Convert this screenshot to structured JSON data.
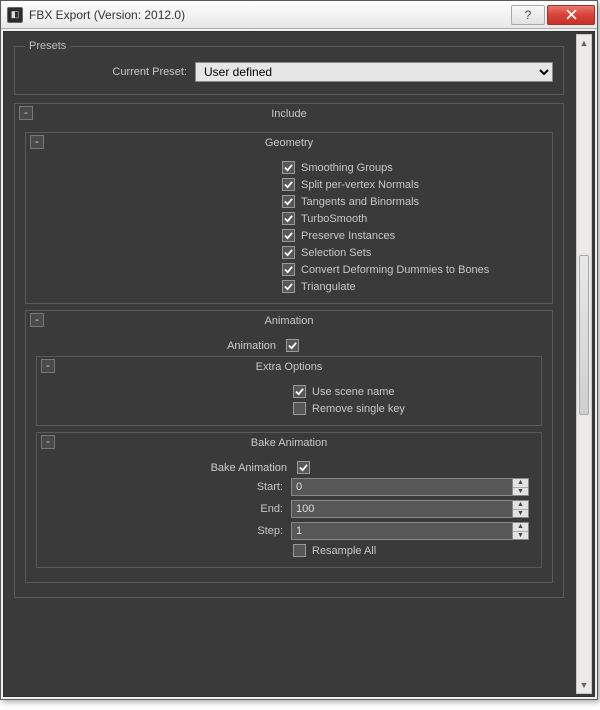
{
  "window": {
    "title": "FBX Export (Version: 2012.0)"
  },
  "presets": {
    "legend": "Presets",
    "current_label": "Current Preset:",
    "current_value": "User defined"
  },
  "include": {
    "title": "Include",
    "geometry": {
      "title": "Geometry",
      "options": [
        {
          "label": "Smoothing Groups",
          "checked": true
        },
        {
          "label": "Split per-vertex Normals",
          "checked": true
        },
        {
          "label": "Tangents and Binormals",
          "checked": true
        },
        {
          "label": "TurboSmooth",
          "checked": true
        },
        {
          "label": "Preserve Instances",
          "checked": true
        },
        {
          "label": "Selection Sets",
          "checked": true
        },
        {
          "label": "Convert Deforming Dummies to Bones",
          "checked": true
        },
        {
          "label": "Triangulate",
          "checked": true
        }
      ]
    },
    "animation": {
      "title": "Animation",
      "toggle_label": "Animation",
      "toggle_checked": true,
      "extra": {
        "title": "Extra Options",
        "options": [
          {
            "label": "Use scene name",
            "checked": true
          },
          {
            "label": "Remove single key",
            "checked": false
          }
        ]
      },
      "bake": {
        "title": "Bake Animation",
        "toggle_label": "Bake Animation",
        "toggle_checked": true,
        "start_label": "Start:",
        "start_value": "0",
        "end_label": "End:",
        "end_value": "100",
        "step_label": "Step:",
        "step_value": "1",
        "resample_label": "Resample All",
        "resample_checked": false
      }
    }
  }
}
